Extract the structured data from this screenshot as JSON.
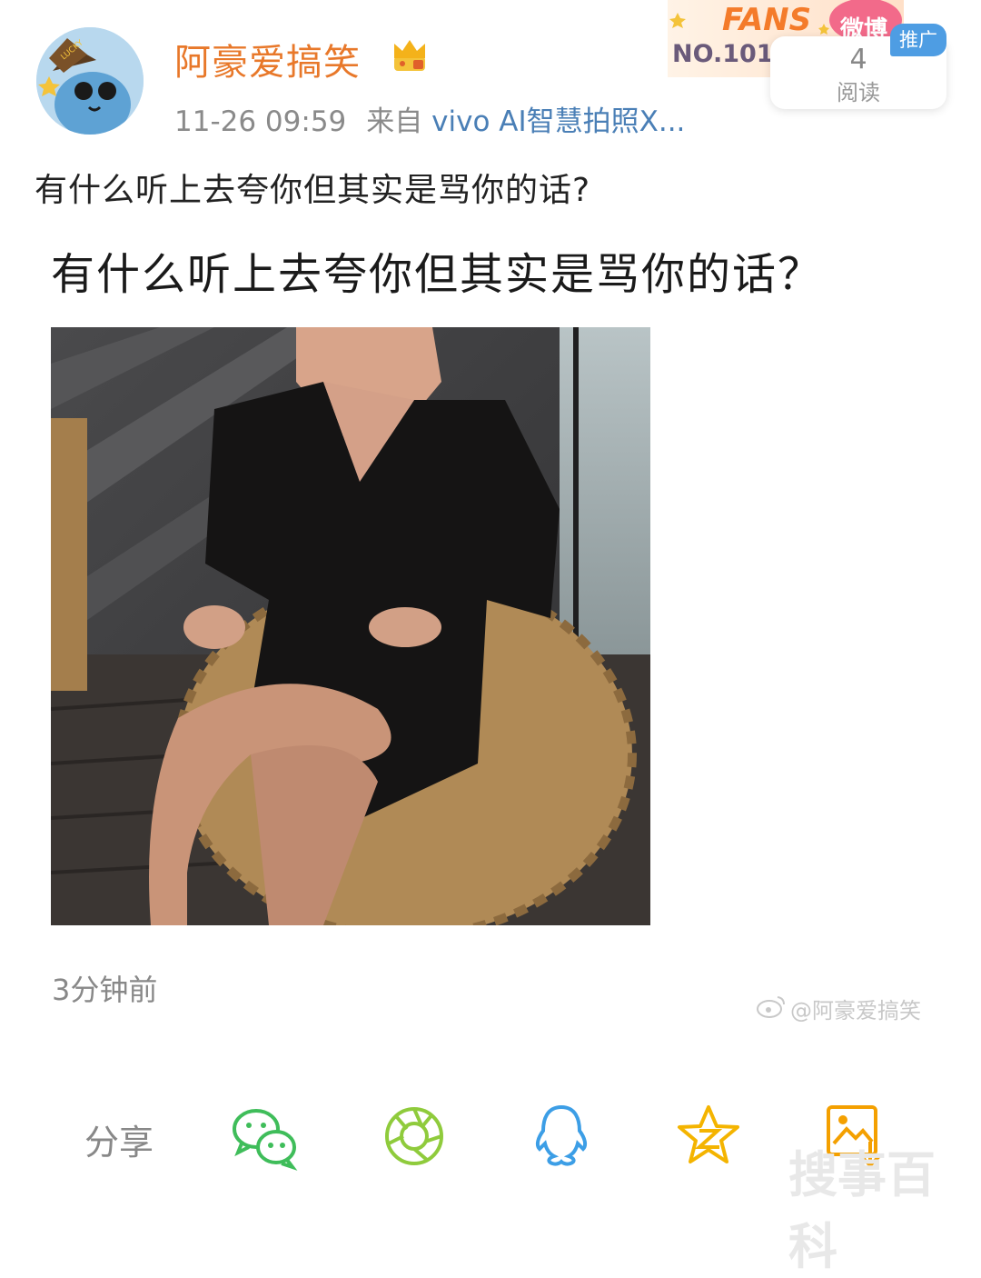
{
  "post": {
    "author": "阿豪爱搞笑",
    "date": "11-26 09:59",
    "source_prefix": "来自",
    "source": "vivo AI智慧拍照X...",
    "text": "有什么听上去夸你但其实是骂你的话?",
    "headline": "有什么听上去夸你但其实是骂你的话？",
    "time_ago": "3分钟前",
    "avatar_badge": "LUCKY"
  },
  "fans_badge": {
    "label": "FANS",
    "sub": "微博",
    "number": "NO.1018"
  },
  "promo": {
    "tag": "推广",
    "read_count": "4",
    "read_label": "阅读"
  },
  "watermark": "@阿豪爱搞笑",
  "share": {
    "label": "分享",
    "buttons": [
      {
        "name": "wechat-icon",
        "color": "#3fbd5a"
      },
      {
        "name": "moments-icon",
        "color": "#8fcb3c"
      },
      {
        "name": "qq-icon",
        "color": "#3c9ee6"
      },
      {
        "name": "qzone-icon",
        "color": "#f4b400"
      },
      {
        "name": "save-image-icon",
        "color": "#f4a000"
      }
    ]
  },
  "corner_watermark": "搜事百科"
}
